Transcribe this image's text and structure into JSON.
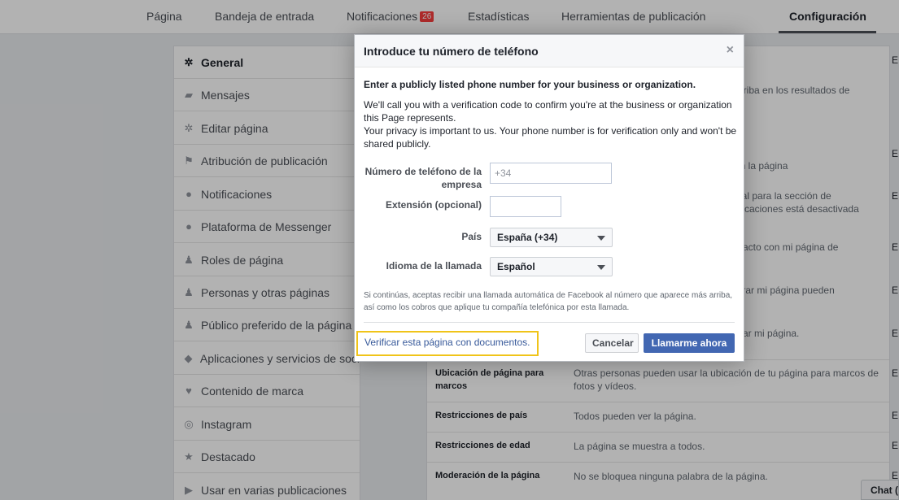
{
  "nav": {
    "items": [
      "Página",
      "Bandeja de entrada",
      "Notificaciones",
      "Estadísticas",
      "Herramientas de publicación",
      "Configuración"
    ],
    "notifications_badge": "26"
  },
  "sidebar": {
    "items": [
      {
        "label": "General",
        "icon": "gear-icon"
      },
      {
        "label": "Mensajes",
        "icon": "messages-icon"
      },
      {
        "label": "Editar página",
        "icon": "gear-icon"
      },
      {
        "label": "Atribución de publicación",
        "icon": "flag-icon"
      },
      {
        "label": "Notificaciones",
        "icon": "globe-icon"
      },
      {
        "label": "Plataforma de Messenger",
        "icon": "messenger-icon"
      },
      {
        "label": "Roles de página",
        "icon": "person-icon"
      },
      {
        "label": "Personas y otras páginas",
        "icon": "add-person-icon"
      },
      {
        "label": "Público preferido de la página",
        "icon": "add-person-icon"
      },
      {
        "label": "Aplicaciones y servicios de soci",
        "icon": "cube-icon"
      },
      {
        "label": "Contenido de marca",
        "icon": "branded-content-icon"
      },
      {
        "label": "Instagram",
        "icon": "instagram-icon"
      },
      {
        "label": "Destacado",
        "icon": "star-icon"
      },
      {
        "label": "Usar en varias publicaciones",
        "icon": "video-icon"
      }
    ]
  },
  "background_rows": {
    "partial_texts": [
      "arriba en los resultados de",
      "en la página",
      "cial para la sección de",
      "plicaciones está desactivada",
      "ntacto con mi página de",
      "strar mi página pueden",
      "etar mi página."
    ],
    "rows": [
      {
        "label": "Ubicación de página para marcos",
        "text": "Otras personas pueden usar la ubicación de tu página para marcos de fotos y vídeos."
      },
      {
        "label": "Restricciones de país",
        "text": "Todos pueden ver la página."
      },
      {
        "label": "Restricciones de edad",
        "text": "La página se muestra a todos."
      },
      {
        "label": "Moderación de la página",
        "text": "No se bloquea ninguna palabra de la página."
      }
    ],
    "edit_letter": "E"
  },
  "dialog": {
    "title": "Introduce tu número de teléfono",
    "close": "×",
    "lead": "Enter a publicly listed phone number for your business or organization.",
    "desc1": "We'll call you with a verification code to confirm you're at the business or organization this Page represents.",
    "desc2": "Your privacy is important to us. Your phone number is for verification only and won't be shared publicly.",
    "phone_label": "Número de teléfono de la empresa",
    "phone_placeholder": "+34",
    "extension_label": "Extensión (opcional)",
    "country_label": "País",
    "country_value": "España (+34)",
    "language_label": "Idioma de la llamada",
    "language_value": "Español",
    "disclaimer": "Si continúas, aceptas recibir una llamada automática de Facebook al número que aparece más arriba, así como los cobros que aplique tu compañía telefónica por esta llamada.",
    "verify_link": "Verificar esta página con documentos.",
    "cancel": "Cancelar",
    "call_now": "Llamarme ahora"
  },
  "chat": {
    "label": "Chat ("
  },
  "colors": {
    "accent": "#4267b2",
    "link": "#365899",
    "highlight": "#f0c419",
    "badge": "#fa3e3e"
  }
}
